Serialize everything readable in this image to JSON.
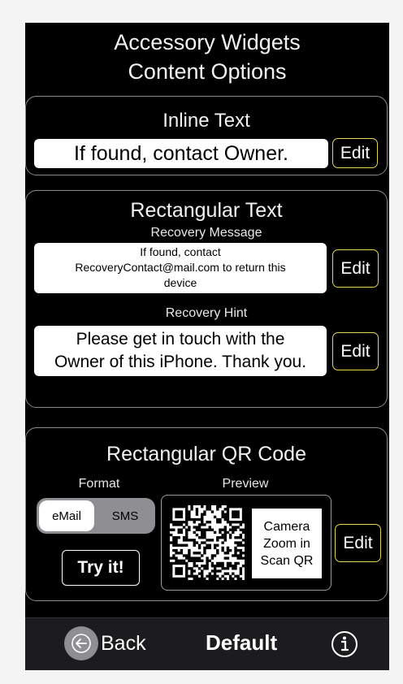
{
  "header": {
    "title_line1": "Accessory Widgets",
    "title_line2": "Content Options"
  },
  "inline": {
    "title": "Inline Text",
    "value": "If found, contact Owner.",
    "edit_label": "Edit"
  },
  "rect": {
    "title": "Rectangular Text",
    "recovery_message_label": "Recovery Message",
    "recovery_message_line1": "If found, contact",
    "recovery_message_line2": "RecoveryContact@mail.com to return this",
    "recovery_message_line3": "device",
    "recovery_hint_label": "Recovery Hint",
    "recovery_hint_line1": "Please get in touch with the",
    "recovery_hint_line2": "Owner of this iPhone. Thank you.",
    "edit_label": "Edit"
  },
  "qr": {
    "title": "Rectangular QR Code",
    "format_label": "Format",
    "preview_label": "Preview",
    "format_options": [
      "eMail",
      "SMS"
    ],
    "selected_format": "eMail",
    "try_label": "Try it!",
    "camera_lines": [
      "Camera",
      "Zoom in",
      "Scan QR"
    ],
    "edit_label": "Edit"
  },
  "bottom_bar": {
    "back_label": "Back",
    "center_label": "Default",
    "info_icon": "info-icon",
    "back_icon": "arrow-left-icon"
  },
  "colors": {
    "background": "#000000",
    "edit_border": "#e6d64a",
    "panel_border": "#8a8a8a",
    "bar": "#1c1c1e"
  }
}
